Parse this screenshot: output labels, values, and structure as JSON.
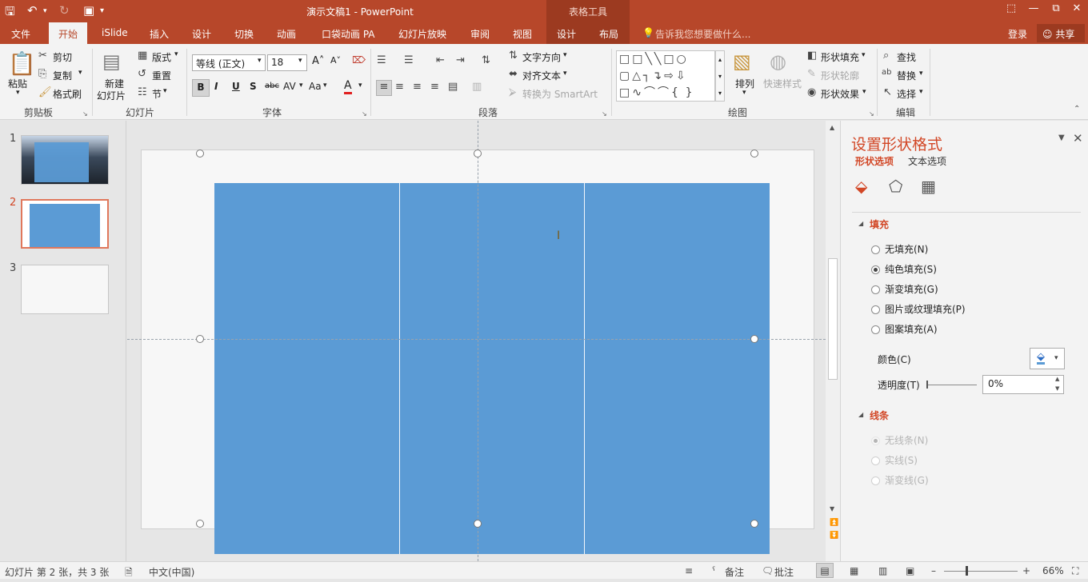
{
  "titlebar": {
    "doc_title": "演示文稿1 - PowerPoint",
    "context_group": "表格工具",
    "icons": [
      "save-icon",
      "undo-icon",
      "redo-icon",
      "slideshow-from-start-icon",
      "ribbon-display-icon",
      "minimize-icon",
      "restore-icon",
      "close-icon"
    ]
  },
  "tabs": {
    "file": "文件",
    "home": "开始",
    "islide": "iSlide",
    "insert": "插入",
    "design": "设计",
    "transitions": "切换",
    "animations": "动画",
    "pocket_anim": "口袋动画 PA",
    "slideshow": "幻灯片放映",
    "review": "审阅",
    "view": "视图",
    "table_design": "设计",
    "table_layout": "布局",
    "tellme": "告诉我您想要做什么...",
    "login": "登录",
    "share": "共享"
  },
  "ribbon": {
    "clipboard": {
      "paste": "粘贴",
      "cut": "剪切",
      "copy": "复制",
      "format_painter": "格式刷",
      "label": "剪贴板"
    },
    "slides": {
      "new_slide_1": "新建",
      "new_slide_2": "幻灯片",
      "layout": "版式",
      "reset": "重置",
      "section": "节",
      "label": "幻灯片"
    },
    "font": {
      "font_name": "等线 (正文)",
      "font_size": "18",
      "bold": "B",
      "italic": "I",
      "underline": "U",
      "shadow": "S",
      "strike": "abc",
      "spacing": "AV",
      "case": "Aa",
      "color": "A",
      "label": "字体"
    },
    "paragraph": {
      "text_direction": "文字方向",
      "align_text": "对齐文本",
      "smartart": "转换为 SmartArt",
      "label": "段落"
    },
    "drawing": {
      "arrange": "排列",
      "quick_styles": "快速样式",
      "shape_fill": "形状填充",
      "shape_outline": "形状轮廓",
      "shape_effects": "形状效果",
      "label": "绘图"
    },
    "editing": {
      "find": "查找",
      "replace": "替换",
      "select": "选择",
      "label": "编辑"
    }
  },
  "thumbnails": [
    "1",
    "2",
    "3"
  ],
  "format_pane": {
    "title": "设置形状格式",
    "tab_shape": "形状选项",
    "tab_text": "文本选项",
    "fill_section": "填充",
    "fill_options": [
      "无填充(N)",
      "纯色填充(S)",
      "渐变填充(G)",
      "图片或纹理填充(P)",
      "图案填充(A)"
    ],
    "color_label": "颜色(C)",
    "transparency_label": "透明度(T)",
    "transparency_value": "0%",
    "line_section": "线条",
    "line_options": [
      "无线条(N)",
      "实线(S)",
      "渐变线(G)"
    ]
  },
  "status": {
    "slide_info": "幻灯片 第 2 张，共 3 张",
    "language": "中文(中国)",
    "notes": "备注",
    "comments": "批注",
    "zoom": "66%"
  },
  "colors": {
    "accent": "#b7472a",
    "table_fill": "#5b9bd5"
  }
}
